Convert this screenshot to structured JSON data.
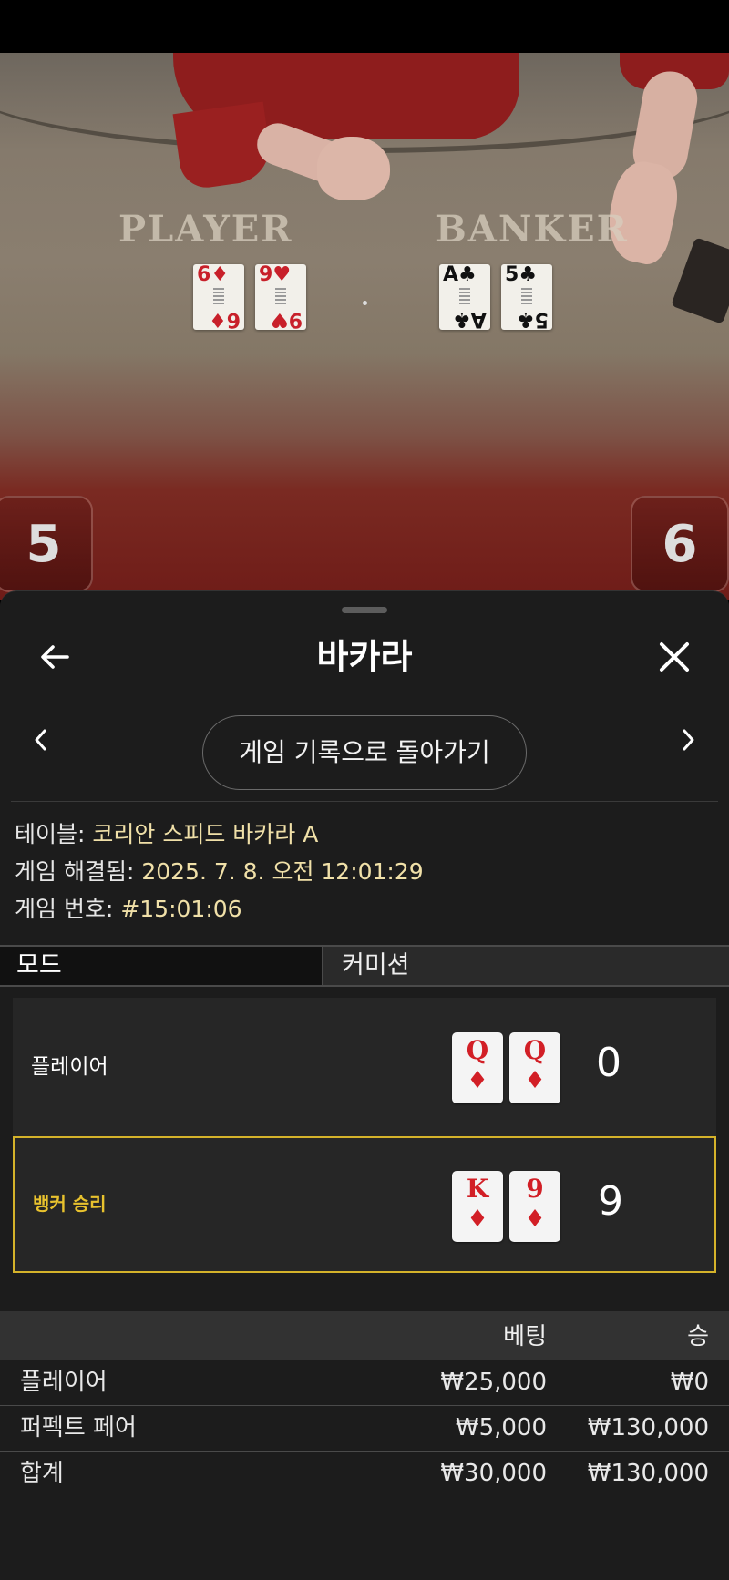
{
  "video": {
    "player_label": "PLAYER",
    "banker_label": "BANKER",
    "player_cards": [
      {
        "rank": "6",
        "suit": "♦",
        "color": "#c8202a"
      },
      {
        "rank": "9",
        "suit": "♥",
        "color": "#c8202a"
      }
    ],
    "banker_cards": [
      {
        "rank": "A",
        "suit": "♣",
        "color": "#111111"
      },
      {
        "rank": "5",
        "suit": "♣",
        "color": "#111111"
      }
    ],
    "player_score": "5",
    "banker_score": "6"
  },
  "header": {
    "title": "바카라",
    "back_icon": "arrow-left-icon",
    "close_icon": "close-icon"
  },
  "navigation": {
    "back_to_history_label": "게임 기록으로 돌아가기",
    "prev_icon": "chevron-left-icon",
    "next_icon": "chevron-right-icon"
  },
  "info": {
    "table_key": "테이블: ",
    "table_value": "코리안 스피드 바카라 A",
    "resolved_key": "게임 해결됨: ",
    "resolved_value": "2025. 7. 8. 오전 12:01:29",
    "game_no_key": "게임 번호: ",
    "game_no_value": "#15:01:06"
  },
  "mode": {
    "label": "모드",
    "value": "커미션"
  },
  "results": {
    "player": {
      "label": "플레이어",
      "cards": [
        {
          "rank": "Q",
          "suit": "♦"
        },
        {
          "rank": "Q",
          "suit": "♦"
        }
      ],
      "score": "0"
    },
    "banker": {
      "label": "뱅커 승리",
      "cards": [
        {
          "rank": "K",
          "suit": "♦"
        },
        {
          "rank": "9",
          "suit": "♦"
        }
      ],
      "score": "9"
    },
    "win_color": "#d4b22a"
  },
  "bets": {
    "headers": {
      "bet": "베팅",
      "win": "승"
    },
    "rows": [
      {
        "name": "플레이어",
        "bet": "₩25,000",
        "win": "₩0"
      },
      {
        "name": "퍼펙트 페어",
        "bet": "₩5,000",
        "win": "₩130,000"
      }
    ],
    "total": {
      "name": "합계",
      "bet": "₩30,000",
      "win": "₩130,000"
    }
  }
}
